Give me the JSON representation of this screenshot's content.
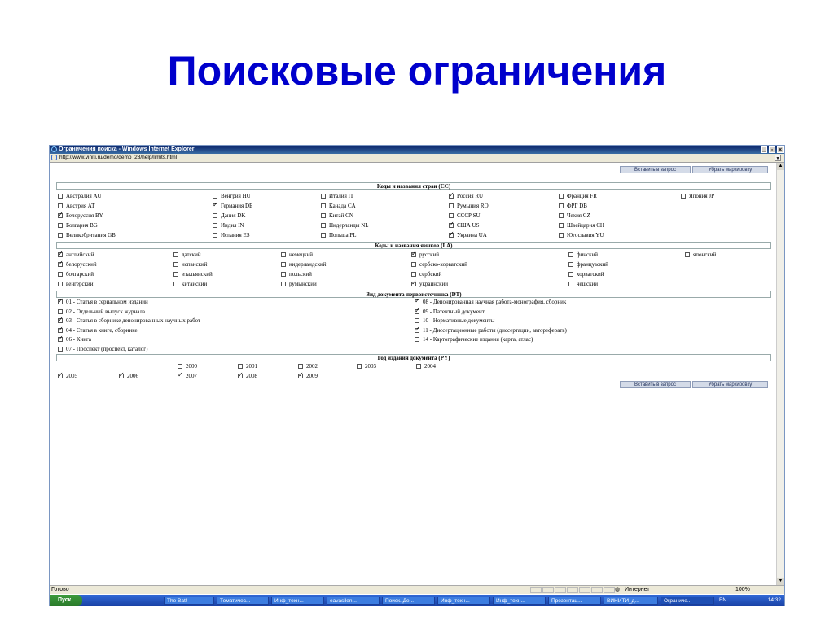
{
  "slide_title": "Поисковые ограничения",
  "window": {
    "title": "Ограничения поиска - Windows Internet Explorer",
    "url": "http://www.viniti.ru/demo/demo_28/help/limits.html",
    "btn_insert": "Вставить в запрос",
    "btn_clear": "Убрать маркировку"
  },
  "sections": {
    "countries": {
      "title": "Коды и названия стран (CC)",
      "items": [
        {
          "label": "Австралия AU",
          "checked": false
        },
        {
          "label": "Венгрия HU",
          "checked": false
        },
        {
          "label": "Италия IT",
          "checked": false
        },
        {
          "label": "Россия RU",
          "checked": true
        },
        {
          "label": "Франция FR",
          "checked": false
        },
        {
          "label": "Япония JP",
          "checked": false
        },
        {
          "label": "Австрия AT",
          "checked": false
        },
        {
          "label": "Германия DE",
          "checked": true
        },
        {
          "label": "Канада CA",
          "checked": false
        },
        {
          "label": "Румыния RO",
          "checked": false
        },
        {
          "label": "ФРГ DB",
          "checked": false
        },
        {
          "label": "Белоруссия BY",
          "checked": true
        },
        {
          "label": "Дания DK",
          "checked": false
        },
        {
          "label": "Китай CN",
          "checked": false
        },
        {
          "label": "СССР SU",
          "checked": false
        },
        {
          "label": "Чехия CZ",
          "checked": false
        },
        {
          "label": "Болгария BG",
          "checked": false
        },
        {
          "label": "Индия IN",
          "checked": false
        },
        {
          "label": "Нидерланды NL",
          "checked": false
        },
        {
          "label": "США US",
          "checked": true
        },
        {
          "label": "Швейцария CH",
          "checked": false
        },
        {
          "label": "Великобритания GB",
          "checked": false
        },
        {
          "label": "Испания ES",
          "checked": false
        },
        {
          "label": "Польша PL",
          "checked": false
        },
        {
          "label": "Украина UA",
          "checked": true
        },
        {
          "label": "Югославия YU",
          "checked": false
        }
      ]
    },
    "languages": {
      "title": "Коды и названия языков (LA)",
      "items": [
        {
          "label": "английский",
          "checked": true
        },
        {
          "label": "датский",
          "checked": false
        },
        {
          "label": "немецкий",
          "checked": false
        },
        {
          "label": "русский",
          "checked": true
        },
        {
          "label": "финский",
          "checked": false
        },
        {
          "label": "японский",
          "checked": false
        },
        {
          "label": "белорусский",
          "checked": true
        },
        {
          "label": "испанский",
          "checked": false
        },
        {
          "label": "нидерландский",
          "checked": false
        },
        {
          "label": "сербско-хорватский",
          "checked": false
        },
        {
          "label": "французский",
          "checked": false
        },
        {
          "label": "болгарский",
          "checked": false
        },
        {
          "label": "итальянский",
          "checked": false
        },
        {
          "label": "польский",
          "checked": false
        },
        {
          "label": "сербский",
          "checked": false
        },
        {
          "label": "хорватский",
          "checked": false
        },
        {
          "label": "венгерский",
          "checked": false
        },
        {
          "label": "китайский",
          "checked": false
        },
        {
          "label": "румынский",
          "checked": false
        },
        {
          "label": "украинский",
          "checked": true
        },
        {
          "label": "чешский",
          "checked": false
        }
      ]
    },
    "doctypes": {
      "title": "Вид документа-первоисточника (DT)",
      "items": [
        {
          "label": "01 - Статья в сериальном издании",
          "checked": true
        },
        {
          "label": "08 - Депонированная научная работа-монография, сборник",
          "checked": true
        },
        {
          "label": "02 - Отдельный выпуск журнала",
          "checked": false
        },
        {
          "label": "09 - Патентный документ",
          "checked": true
        },
        {
          "label": "03 - Статья в сборнике депонированных научных работ",
          "checked": true
        },
        {
          "label": "10 - Нормативные документы",
          "checked": false
        },
        {
          "label": "04 - Статья в книге, сборнике",
          "checked": true
        },
        {
          "label": "11 - Диссертационные работы (диссертации, автореферать)",
          "checked": true
        },
        {
          "label": "06 - Книга",
          "checked": true
        },
        {
          "label": "14 - Картографические издания (карта, атлас)",
          "checked": false
        },
        {
          "label": "07 - Проспект (проспект, каталог)",
          "checked": false
        }
      ]
    },
    "years": {
      "title": "Год издания документа (PY)",
      "items": [
        {
          "label": "2000",
          "checked": false
        },
        {
          "label": "2001",
          "checked": false
        },
        {
          "label": "2002",
          "checked": false
        },
        {
          "label": "2003",
          "checked": false
        },
        {
          "label": "2004",
          "checked": false
        },
        {
          "label": "2005",
          "checked": true
        },
        {
          "label": "2006",
          "checked": true
        },
        {
          "label": "2007",
          "checked": true
        },
        {
          "label": "2008",
          "checked": true
        },
        {
          "label": "2009",
          "checked": true
        }
      ]
    }
  },
  "status": {
    "ready": "Готово",
    "zone": "Интернет",
    "zoom": "100%"
  },
  "taskbar": {
    "start": "Пуск",
    "tasks": [
      "The Bat!",
      "Тематичес...",
      "Инф_техн...",
      "eavasilen...",
      "Поиск. Де...",
      "Инф_техн...",
      "Инф_техн...",
      "Презентац...",
      "ВИНИТИ_д...",
      "Ограниче..."
    ],
    "lang": "EN",
    "clock": "14:32"
  }
}
